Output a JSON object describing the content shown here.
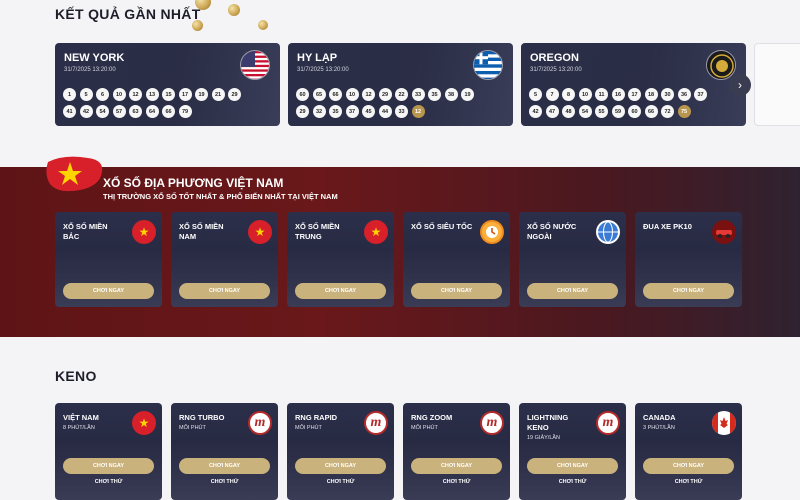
{
  "results_title": "KẾT QUẢ GẦN NHẤT",
  "result_cards": [
    {
      "name": "NEW YORK",
      "date": "31/7/2025 13:20:00",
      "flag": "usa-flag-icon",
      "balls": [
        "1",
        "5",
        "6",
        "10",
        "12",
        "13",
        "15",
        "17",
        "19",
        "21",
        "29",
        "41",
        "42",
        "54",
        "57",
        "63",
        "64",
        "66",
        "79"
      ],
      "gold": []
    },
    {
      "name": "HY LẠP",
      "date": "31/7/2025 13:20:00",
      "flag": "greece-flag-icon",
      "balls": [
        "60",
        "65",
        "66",
        "10",
        "12",
        "29",
        "22",
        "33",
        "35",
        "38",
        "19",
        "29",
        "32",
        "35",
        "37",
        "45",
        "44",
        "33",
        "12"
      ],
      "gold": [
        "12"
      ]
    },
    {
      "name": "OREGON",
      "date": "31/7/2025 13:20:00",
      "flag": "oregon-seal-icon",
      "balls": [
        "5",
        "7",
        "8",
        "10",
        "11",
        "16",
        "17",
        "18",
        "30",
        "36",
        "37",
        "42",
        "47",
        "48",
        "54",
        "55",
        "59",
        "60",
        "66",
        "72",
        "75"
      ],
      "gold": [
        "75"
      ]
    }
  ],
  "next_icon": "›",
  "vietnam": {
    "title": "XỔ SỐ ĐỊA PHƯƠNG VIỆT NAM",
    "subtitle": "THỊ TRƯỜNG XỔ SỐ TỐT NHẤT & PHỔ BIẾN NHẤT TẠI VIỆT NAM",
    "play_label": "CHƠI NGAY",
    "cards": [
      {
        "name": "XỔ SỐ MIỀN BẮC",
        "icon": "vietnam-star-icon"
      },
      {
        "name": "XỔ SỐ MIỀN NAM",
        "icon": "vietnam-star-icon"
      },
      {
        "name": "XỔ SỐ MIỀN TRUNG",
        "icon": "vietnam-star-icon"
      },
      {
        "name": "XỔ SỐ SIÊU TỐC",
        "icon": "speed-lottery-icon"
      },
      {
        "name": "XỔ SỐ NƯỚC NGOÀI",
        "icon": "globe-icon"
      },
      {
        "name": "ĐUA XE PK10",
        "icon": "race-car-icon"
      }
    ]
  },
  "keno": {
    "title": "KENO",
    "play_label": "CHƠI NGAY",
    "try_label": "CHƠI THỬ",
    "cards": [
      {
        "name": "VIỆT NAM",
        "sub": "8 PHÚT/LẦN",
        "icon": "vietnam-flag-icon"
      },
      {
        "name": "RNG TURBO",
        "sub": "MỖI PHÚT",
        "icon": "m-logo-icon"
      },
      {
        "name": "RNG RAPID",
        "sub": "MỖI PHÚT",
        "icon": "m-logo-icon"
      },
      {
        "name": "RNG ZOOM",
        "sub": "MỖI PHÚT",
        "icon": "m-logo-icon"
      },
      {
        "name": "LIGHTNING KENO",
        "sub": "19 GIÂY/LẦN",
        "icon": "m-logo-icon"
      },
      {
        "name": "CANADA",
        "sub": "3 PHÚT/LẦN",
        "icon": "canada-flag-icon"
      }
    ]
  }
}
